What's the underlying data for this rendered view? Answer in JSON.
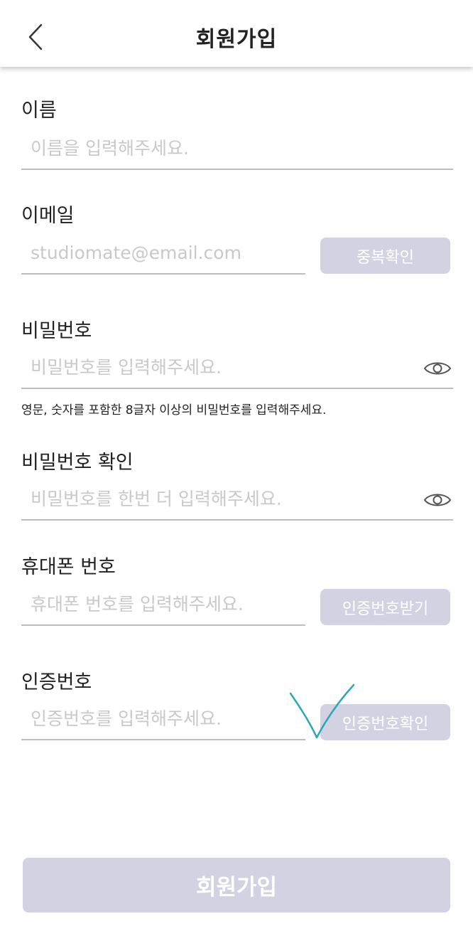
{
  "header": {
    "title": "회원가입",
    "back_icon": "chevron-left-icon"
  },
  "form": {
    "name": {
      "label": "이름",
      "placeholder": "이름을 입력해주세요."
    },
    "email": {
      "label": "이메일",
      "placeholder": "studiomate@email.com",
      "button_label": "중복확인"
    },
    "password": {
      "label": "비밀번호",
      "placeholder": "비밀번호를 입력해주세요.",
      "hint": "영문, 숫자를 포함한 8글자 이상의 비밀번호를 입력해주세요.",
      "toggle_icon": "eye-icon"
    },
    "password_confirm": {
      "label": "비밀번호 확인",
      "placeholder": "비밀번호를 한번 더 입력해주세요.",
      "toggle_icon": "eye-icon"
    },
    "phone": {
      "label": "휴대폰 번호",
      "placeholder": "휴대폰 번호를 입력해주세요.",
      "button_label": "인증번호받기"
    },
    "verification": {
      "label": "인증번호",
      "placeholder": "인증번호를 입력해주세요.",
      "button_label": "인증번호확인"
    }
  },
  "submit": {
    "label": "회원가입"
  },
  "colors": {
    "button_disabled": "#d3d2e2",
    "underline": "#bdbdbd",
    "placeholder": "#c9c9c9",
    "annotation_stroke": "#2aa8b8"
  }
}
